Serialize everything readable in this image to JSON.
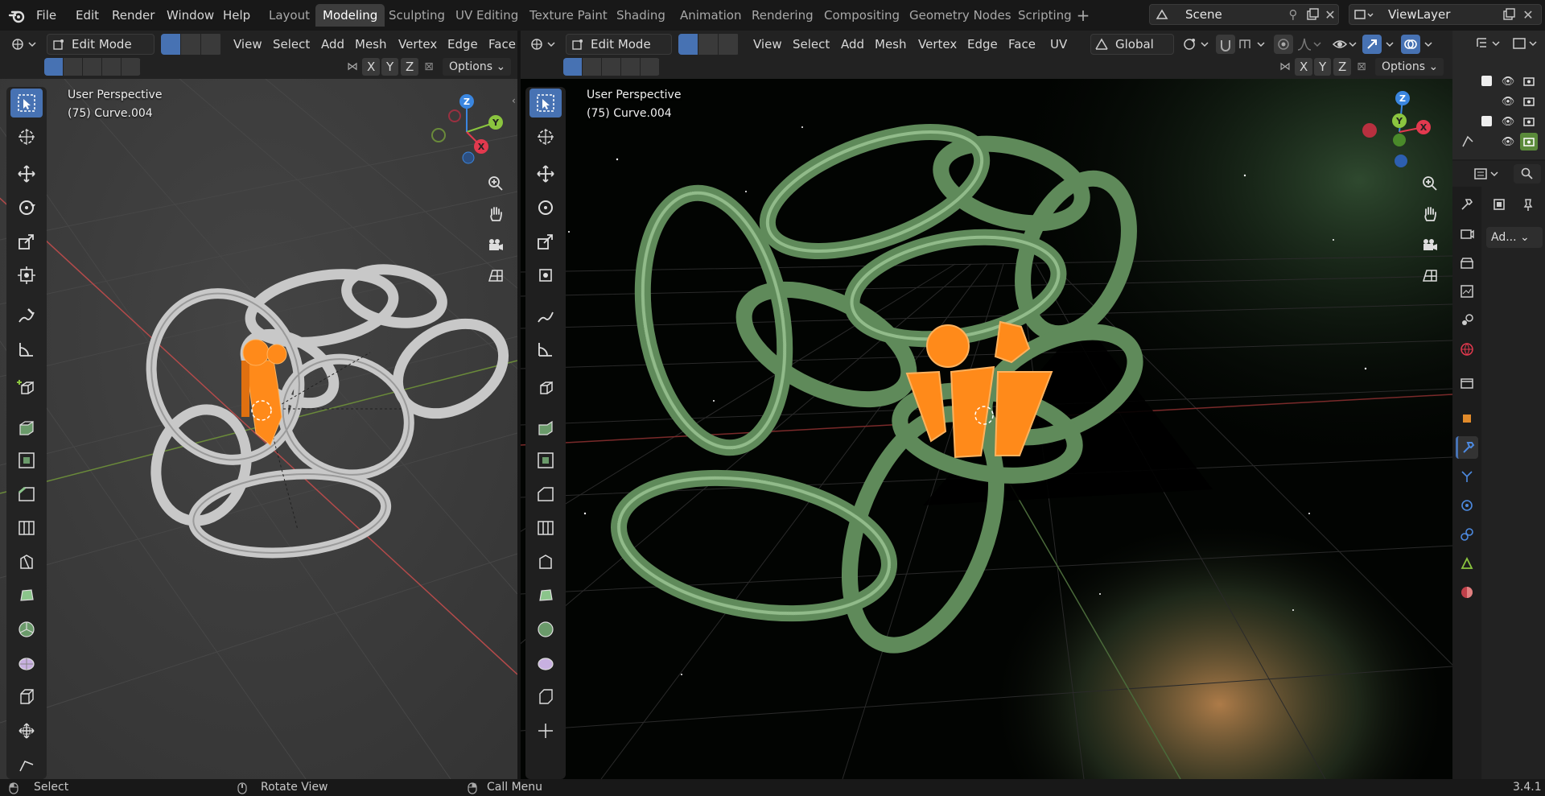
{
  "menus": [
    "File",
    "Edit",
    "Render",
    "Window",
    "Help"
  ],
  "workspaces": [
    "Layout",
    "Modeling",
    "Sculpting",
    "UV Editing",
    "Texture Paint",
    "Shading",
    "Animation",
    "Rendering",
    "Compositing",
    "Geometry Nodes",
    "Scripting"
  ],
  "active_workspace": "Modeling",
  "scene": {
    "label": "Scene"
  },
  "view_layer": {
    "label": "ViewLayer"
  },
  "viewport_left": {
    "mode": "Edit Mode",
    "menus": [
      "View",
      "Select",
      "Add",
      "Mesh",
      "Vertex",
      "Edge",
      "Face"
    ],
    "options": "Options",
    "perspective": "User Perspective",
    "object": "(75) Curve.004",
    "axes": [
      "X",
      "Y",
      "Z"
    ]
  },
  "viewport_right": {
    "mode": "Edit Mode",
    "menus": [
      "View",
      "Select",
      "Add",
      "Mesh",
      "Vertex",
      "Edge",
      "Face",
      "UV"
    ],
    "transform": "Global",
    "options": "Options",
    "perspective": "User Perspective",
    "object": "(75) Curve.004",
    "axes": [
      "X",
      "Y",
      "Z"
    ]
  },
  "properties": {
    "add_modifier": "Ad..."
  },
  "status": {
    "select": "Select",
    "rotate": "Rotate View",
    "menu": "Call Menu",
    "version": "3.4.1"
  },
  "colors": {
    "accent": "#4772b3",
    "selected_mesh": "#ff8a1a",
    "chain_green": "#8fc08a",
    "axis_x": "#e2394e",
    "axis_y": "#8bc53f",
    "axis_z": "#3a86e0"
  }
}
